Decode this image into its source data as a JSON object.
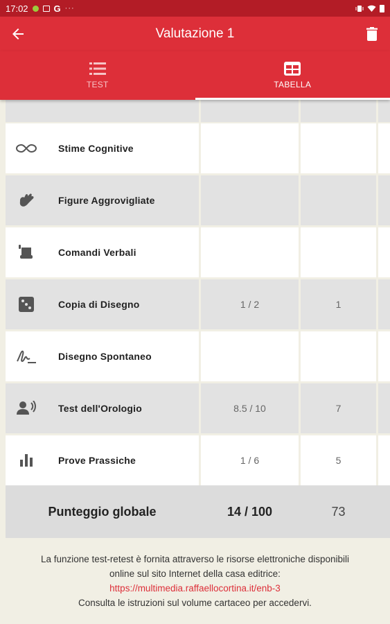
{
  "status_bar": {
    "time": "17:02",
    "g_label": "G",
    "more": "···"
  },
  "app_bar": {
    "title": "Valutazione 1"
  },
  "tabs": [
    {
      "label": "TEST",
      "icon": "list-icon",
      "active": false
    },
    {
      "label": "TABELLA",
      "icon": "table-icon",
      "active": true
    }
  ],
  "table": {
    "rows": [
      {
        "label": "Stime Cognitive",
        "icon": "infinity-icon",
        "v1": "",
        "v2": ""
      },
      {
        "label": "Figure Aggrovigliate",
        "icon": "hand-sign-icon",
        "v1": "",
        "v2": ""
      },
      {
        "label": "Comandi Verbali",
        "icon": "scroll-icon",
        "v1": "",
        "v2": ""
      },
      {
        "label": "Copia di Disegno",
        "icon": "dice-icon",
        "v1": "1 / 2",
        "v2": "1"
      },
      {
        "label": "Disegno Spontaneo",
        "icon": "signature-icon",
        "v1": "",
        "v2": ""
      },
      {
        "label": "Test dell'Orologio",
        "icon": "voice-person-icon",
        "v1": "8.5 / 10",
        "v2": "7"
      },
      {
        "label": "Prove Prassiche",
        "icon": "bar-chart-icon",
        "v1": "1 / 6",
        "v2": "5"
      }
    ],
    "total": {
      "label": "Punteggio globale",
      "v1": "14 / 100",
      "v2": "73"
    }
  },
  "footer": {
    "line1": "La funzione test-retest è fornita attraverso le risorse elettroniche disponibili",
    "line2": "online sul sito Internet della casa editrice:",
    "link": "https://multimedia.raffaellocortina.it/enb-3",
    "line3": "Consulta le istruzioni sul volume cartaceo per accedervi."
  },
  "colors": {
    "primary": "#dd2f39",
    "status_bar": "#b31c26",
    "row_grey": "#e2e2e2",
    "background": "#f1efe4"
  }
}
